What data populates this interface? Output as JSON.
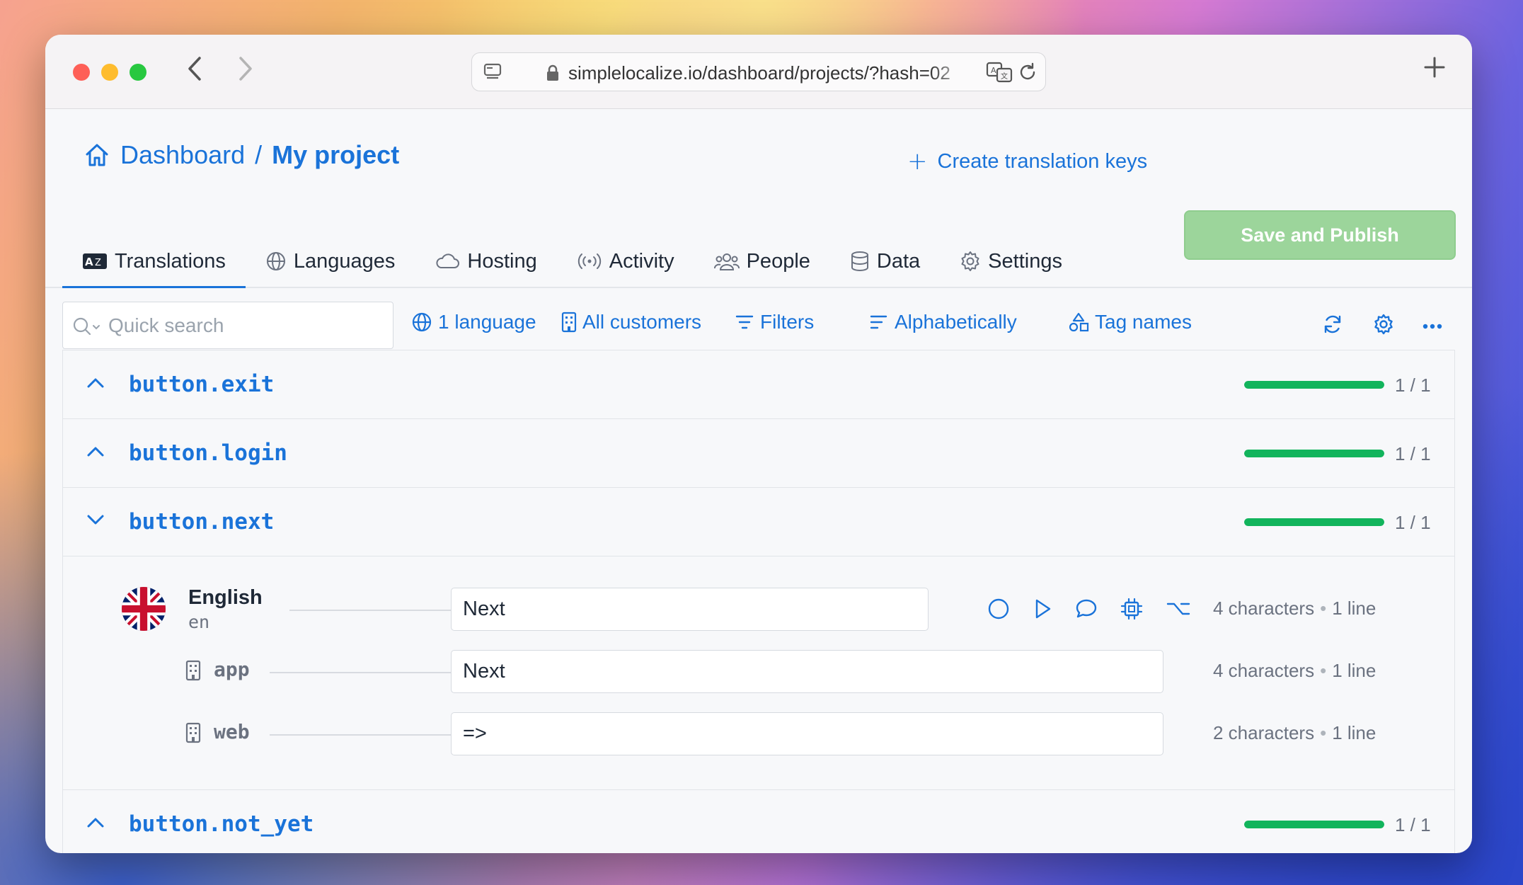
{
  "browser": {
    "url": "simplelocalize.io/dashboard/projects/?hash=02"
  },
  "header": {
    "breadcrumb_root": "Dashboard",
    "breadcrumb_separator": "/",
    "breadcrumb_current": "My project",
    "create_keys_label": "Create translation keys",
    "save_label": "Save and Publish"
  },
  "tabs": [
    {
      "label": "Translations",
      "icon": "translate-icon",
      "active": true
    },
    {
      "label": "Languages",
      "icon": "globe-icon"
    },
    {
      "label": "Hosting",
      "icon": "cloud-icon"
    },
    {
      "label": "Activity",
      "icon": "broadcast-icon"
    },
    {
      "label": "People",
      "icon": "people-icon"
    },
    {
      "label": "Data",
      "icon": "database-icon"
    },
    {
      "label": "Settings",
      "icon": "gear-icon"
    }
  ],
  "toolbar": {
    "search_placeholder": "Quick search",
    "languages": "1 language",
    "customers": "All customers",
    "filters": "Filters",
    "sort": "Alphabetically",
    "tags": "Tag names"
  },
  "keys": [
    {
      "name": "button.exit",
      "count": "1 / 1",
      "progress": 1.0,
      "expanded": false
    },
    {
      "name": "button.login",
      "count": "1 / 1",
      "progress": 1.0,
      "expanded": false
    },
    {
      "name": "button.next",
      "count": "1 / 1",
      "progress": 1.0,
      "expanded": true
    },
    {
      "name": "button.not_yet",
      "count": "1 / 1",
      "progress": 1.0,
      "expanded": false
    }
  ],
  "expanded_key": {
    "language_name": "English",
    "language_code": "en",
    "main_value": "Next",
    "main_meta_chars": "4 characters",
    "main_meta_lines": "1 line",
    "customers": [
      {
        "name": "app",
        "value": "Next",
        "chars": "4 characters",
        "lines": "1 line"
      },
      {
        "name": "web",
        "value": "=>",
        "chars": "2 characters",
        "lines": "1 line"
      }
    ],
    "meta_separator": "•"
  },
  "colors": {
    "accent": "#1a73d9",
    "progress": "#12b45c",
    "save_button": "#9cd59b"
  }
}
